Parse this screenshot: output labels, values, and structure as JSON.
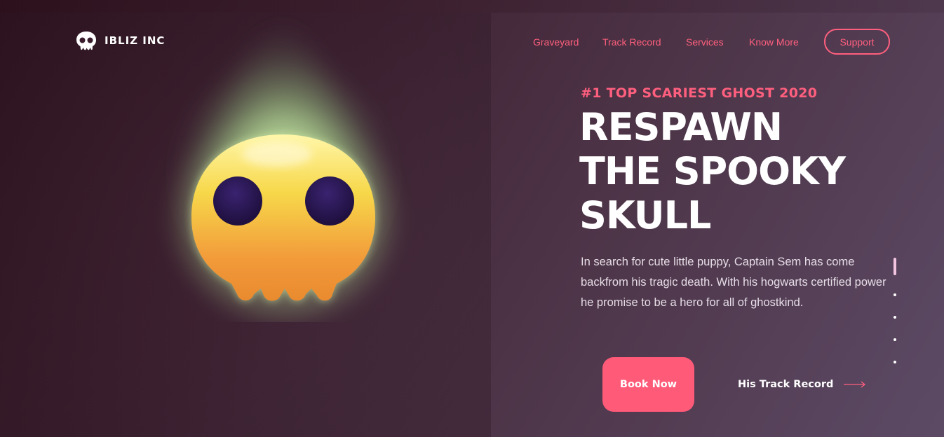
{
  "brand": {
    "name": "IBLIZ INC",
    "logo_icon": "skull-icon"
  },
  "nav": {
    "items": [
      {
        "label": "Graveyard"
      },
      {
        "label": "Track Record"
      },
      {
        "label": "Services"
      },
      {
        "label": "Know More"
      }
    ],
    "support_label": "Support"
  },
  "hero": {
    "kicker": "#1 TOP SCARIEST GHOST 2020",
    "headline": [
      "RESPAWN",
      "THE SPOOKY",
      "SKULL"
    ],
    "description": "In search for cute little puppy, Captain Sem has come backfrom his tragic death. With his hogwarts certified power he promise to be a hero for all of ghostkind.",
    "primary_cta": "Book Now",
    "secondary_cta": "His Track Record",
    "secondary_icon": "arrow-right-icon"
  },
  "pager": {
    "total": 5,
    "active_index": 0
  },
  "colors": {
    "accent": "#ff5f7e",
    "button": "#ff5a78",
    "skull_top": "#f6ec7a",
    "skull_bottom": "#ee8a2e",
    "eyes": "#2a1550",
    "glow": "#b8e6a0"
  }
}
